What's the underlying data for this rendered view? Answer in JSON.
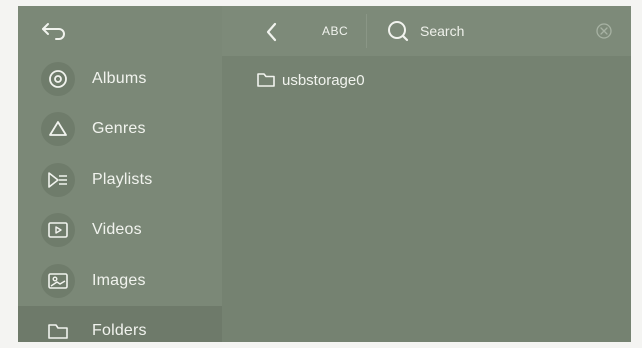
{
  "sidebar": {
    "items": [
      {
        "label": "Albums",
        "icon": "disc-icon"
      },
      {
        "label": "Genres",
        "icon": "triangle-icon"
      },
      {
        "label": "Playlists",
        "icon": "playlist-icon"
      },
      {
        "label": "Videos",
        "icon": "video-icon"
      },
      {
        "label": "Images",
        "icon": "image-icon"
      },
      {
        "label": "Folders",
        "icon": "folder-icon"
      }
    ],
    "active_item": "Folders"
  },
  "toolbar": {
    "abc_label": "ABC",
    "search_placeholder": "Search"
  },
  "content": {
    "folders": [
      {
        "name": "usbstorage0"
      }
    ]
  },
  "colors": {
    "panel": "#778472",
    "sidebar": "#7b8877",
    "active_item": "#6e7a6a",
    "text": "#f1f3ee"
  }
}
